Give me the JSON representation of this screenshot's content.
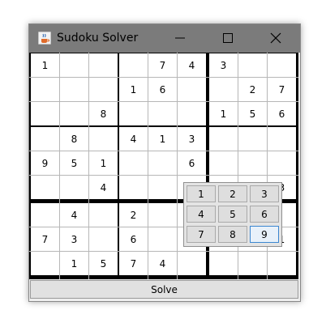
{
  "window": {
    "title": "Sudoku Solver",
    "app_icon": "java-cup-icon",
    "controls": [
      "minimize-icon",
      "maximize-icon",
      "close-icon"
    ],
    "titlebar_color": "#7b7b7b"
  },
  "grid": {
    "rows": [
      [
        "1",
        "",
        "",
        "",
        "7",
        "4",
        "3",
        "",
        ""
      ],
      [
        "",
        "",
        "",
        "1",
        "6",
        "",
        "",
        "2",
        "7"
      ],
      [
        "",
        "",
        "8",
        "",
        "",
        "",
        "1",
        "5",
        "6"
      ],
      [
        "",
        "8",
        "",
        "4",
        "1",
        "3",
        "",
        "",
        ""
      ],
      [
        "9",
        "5",
        "1",
        "",
        "",
        "6",
        "",
        "",
        ""
      ],
      [
        "",
        "",
        "4",
        "",
        "",
        "",
        "",
        "",
        "3"
      ],
      [
        "",
        "4",
        "",
        "2",
        "",
        "",
        "",
        "",
        ""
      ],
      [
        "7",
        "3",
        "",
        "6",
        "",
        "",
        "",
        "",
        "1"
      ],
      [
        "",
        "1",
        "5",
        "7",
        "4",
        "",
        "",
        "",
        ""
      ]
    ]
  },
  "picker": {
    "buttons": [
      "1",
      "2",
      "3",
      "4",
      "5",
      "6",
      "7",
      "8",
      "9"
    ],
    "selected": "9",
    "selected_color": "#3c87d0"
  },
  "solve_button": {
    "label": "Solve"
  }
}
